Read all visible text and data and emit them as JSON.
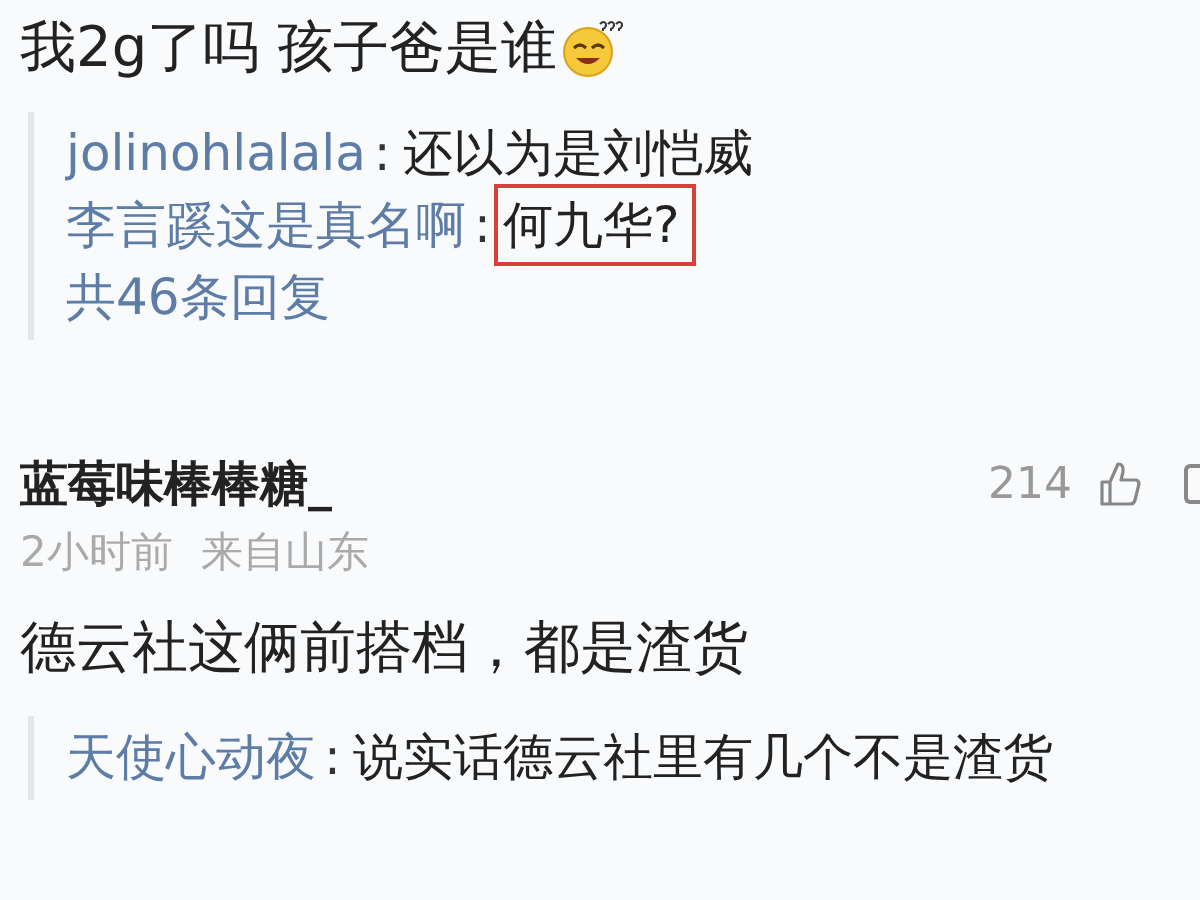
{
  "comments": [
    {
      "body": "我2g了吗 孩子爸是谁",
      "emoji": true,
      "replies": [
        {
          "user": "jolinohlalala",
          "separator": ":",
          "text": "还以为是刘恺威",
          "highlighted": false
        },
        {
          "user": "李言蹊这是真名啊",
          "separator": ":",
          "text": "何九华?",
          "highlighted": true
        }
      ],
      "reply_count": "共46条回复"
    },
    {
      "user": "蓝莓味棒棒糖_",
      "likes": "214",
      "time": "2小时前",
      "location": "来自山东",
      "body": "德云社这俩前搭档，都是渣货",
      "emoji": false,
      "replies": [
        {
          "user": "天使心动夜",
          "separator": ":",
          "text": "说实话德云社里有几个不是渣货",
          "highlighted": false
        }
      ]
    }
  ]
}
